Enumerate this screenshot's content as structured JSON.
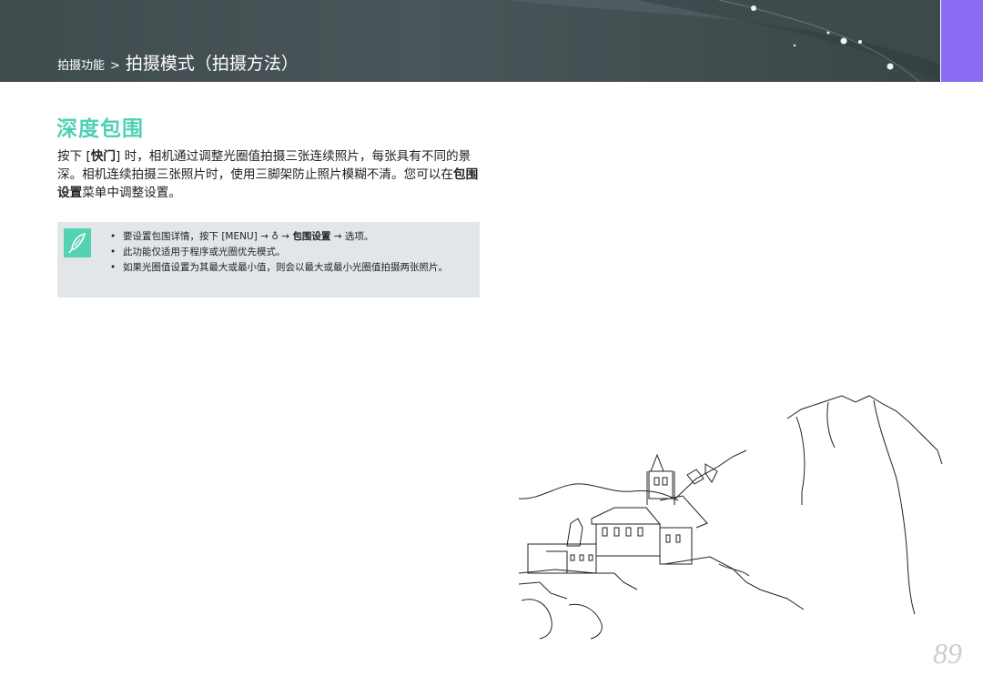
{
  "header": {
    "breadcrumb_section": "拍摄功能",
    "breadcrumb_separator": ">",
    "breadcrumb_current": "拍摄模式（拍摄方法）"
  },
  "section": {
    "title": "深度包围"
  },
  "body": {
    "p1_before": "按下 [",
    "p1_key": "快门",
    "p1_after": "] 时，相机通过调整光圈值拍摄三张连续照片，每张具有不同的景深。相机连续拍摄三张照片时，使用三脚架防止照片模糊不清。您可以在",
    "p1_menu": "包围设置",
    "p1_end": "菜单中调整设置。"
  },
  "note": {
    "icon": "pencil-note-icon",
    "bullet": "•",
    "item1_before": "要设置包围详情，按下 [MENU] → ",
    "item1_camera_glyph": "♁",
    "item1_mid": " → ",
    "item1_menu": "包围设置",
    "item1_after": " → 选项。",
    "item2": "此功能仅适用于程序或光圈优先模式。",
    "item3": "如果光圈值设置为其最大或最小值，则会以最大或最小光圈值拍摄两张照片。"
  },
  "page": {
    "number": "89"
  },
  "colors": {
    "header_bg": "#44505a",
    "title_accent": "#4fd0b5",
    "note_bg": "#e3e6e8",
    "note_icon_bg": "#55d2b1",
    "side_tab": "#8a6cf2",
    "page_number": "#c9ced2"
  }
}
